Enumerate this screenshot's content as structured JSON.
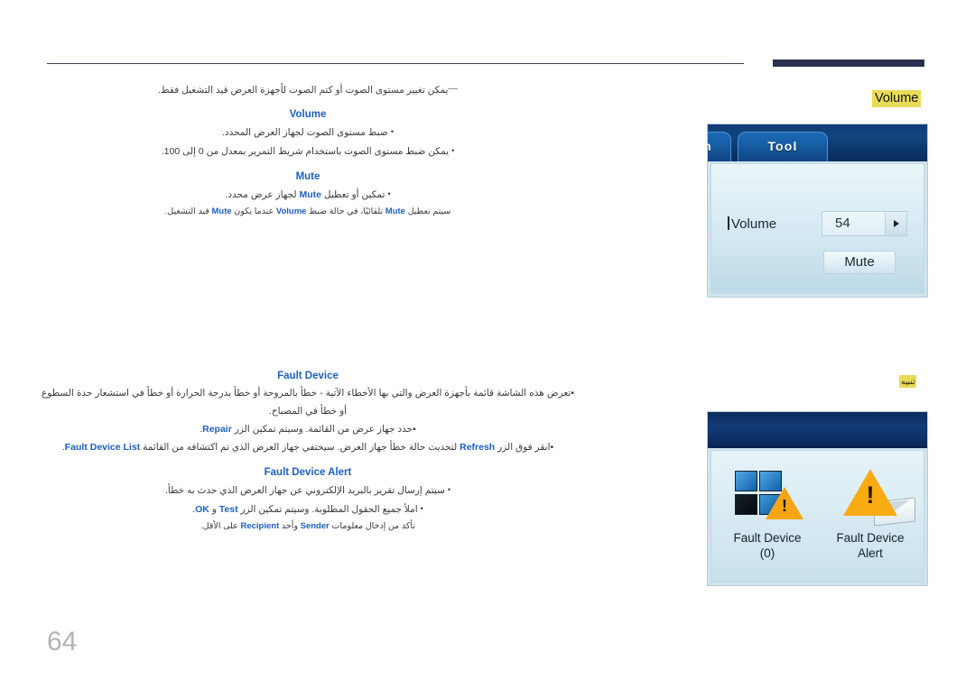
{
  "page": {
    "number": "64"
  },
  "content": {
    "note": {
      "dash": "―",
      "text": "يمكن تغيير مستوى الصوت أو كتم الصوت لأجهزة العرض قيد التشغيل فقط."
    },
    "volume": {
      "heading": "Volume",
      "bullets": [
        {
          "bullet": "•",
          "text": "ضبط مستوى الصوت لجهاز العرض المحدد."
        },
        {
          "bullet": "•",
          "text": "يمكن ضبط مستوى الصوت باستخدام شريط التمرير بمعدل من 0 إلى 100."
        }
      ]
    },
    "mute": {
      "heading": "Mute",
      "bullet": "•",
      "bullet_pre": "تمكين أو تعطيل ",
      "bullet_kw": "Mute",
      "bullet_post": " لجهاز عرض محدد.",
      "sub_p1": "سيتم تعطيل ",
      "sub_kw1": "Mute",
      "sub_p2": " تلقائيًا، في حالة ضبط ",
      "sub_kw2": "Volume",
      "sub_p3": " عندما يكون ",
      "sub_kw3": "Mute",
      "sub_p4": " قيد التشغيل."
    },
    "fault_device": {
      "heading": "Fault Device",
      "bullets": [
        {
          "bullet": "•",
          "text": "تعرض هذه الشاشة قائمة بأجهزة العرض والتي بها الأخطاء الآتية - خطأ بالمروحة أو خطأ بدرجة الحرارة أو خطأ في استشعار حدة السطوع أو خطأ في المصباح."
        }
      ],
      "line2": {
        "bullet": "•",
        "pre": "حدد جهاز عرض من القائمة. وسيتم تمكين الزر ",
        "kw": "Repair",
        "post": "."
      },
      "line3": {
        "bullet": "•",
        "p1": "انقر فوق الزر ",
        "kw1": "Refresh",
        "p2": " لتحديث حالة خطأ جهاز العرض. سيختفي جهاز العرض الذي تم اكتشافه من القائمة ",
        "kw2": "Fault Device List",
        "p3": "."
      }
    },
    "fault_device_alert": {
      "heading": "Fault Device Alert",
      "line1": {
        "bullet": "•",
        "text": "سيتم إرسال تقرير بالبريد الإلكتروني عن جهاز العرض الذي حدث به خطأ."
      },
      "line2": {
        "bullet": "•",
        "p1": "املأ جميع الحقول المطلوبة. وسيتم تمكين الزر ",
        "kw1": "Test",
        "p2": " و ",
        "kw2": "OK",
        "p3": "."
      },
      "line3": {
        "p1": "تأكد من إدخال معلومات ",
        "kw1": "Sender",
        "p2": " وأحد ",
        "kw2": "Recipient",
        "p3": " على الأقل."
      }
    }
  },
  "figures": {
    "volume_tag": "Volume",
    "alert_tag": "تنبيه",
    "volume_shot": {
      "tab_prev": "n",
      "tab_tool": "Tool",
      "volume_label": "Volume",
      "volume_value": "54",
      "arrow_icon": "right-arrow-icon",
      "mute_button": "Mute"
    },
    "fault_shot": {
      "item1_caption_line1": "Fault Device",
      "item1_caption_line2": "(0)",
      "item2_caption_line1": "Fault Device",
      "item2_caption_line2": "Alert",
      "item1_icon": "fault-device-monitors-icon",
      "item2_icon": "fault-device-alert-icon"
    }
  },
  "colors": {
    "accent_blue": "#1d5fc4",
    "highlight_yellow": "#e8db57",
    "header_bar": "#2b3050",
    "page_number": "#b3b3b3"
  }
}
